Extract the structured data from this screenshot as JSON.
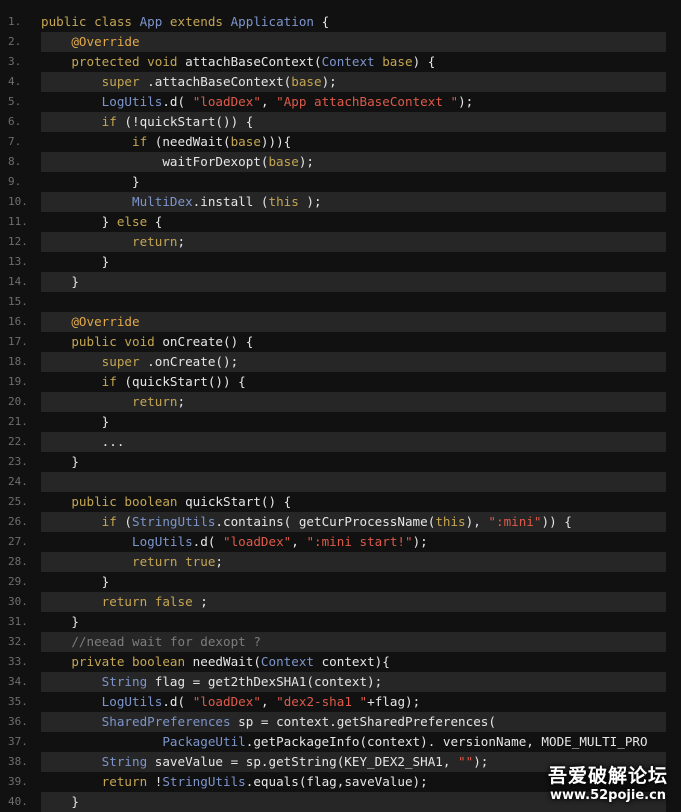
{
  "lines": [
    [
      [
        "kw",
        "public class "
      ],
      [
        "cls",
        "App"
      ],
      [
        "kw",
        " extends "
      ],
      [
        "cls",
        "Application"
      ],
      [
        "txt",
        " {"
      ]
    ],
    [
      [
        "txt",
        "    "
      ],
      [
        "ann",
        "@Override"
      ]
    ],
    [
      [
        "txt",
        "    "
      ],
      [
        "kw",
        "protected void "
      ],
      [
        "txt",
        "attachBaseContext("
      ],
      [
        "cls",
        "Context"
      ],
      [
        "kw",
        " base"
      ],
      [
        "txt",
        ") {"
      ]
    ],
    [
      [
        "txt",
        "        "
      ],
      [
        "kw",
        "super"
      ],
      [
        "txt",
        " .attachBaseContext("
      ],
      [
        "kw",
        "base"
      ],
      [
        "txt",
        ");"
      ]
    ],
    [
      [
        "txt",
        "        "
      ],
      [
        "cls",
        "LogUtils"
      ],
      [
        "txt",
        ".d( "
      ],
      [
        "str",
        "\"loadDex\""
      ],
      [
        "txt",
        ", "
      ],
      [
        "str",
        "\"App attachBaseContext \""
      ],
      [
        "txt",
        ");"
      ]
    ],
    [
      [
        "txt",
        "        "
      ],
      [
        "kw",
        "if"
      ],
      [
        "txt",
        " (!quickStart()) {"
      ]
    ],
    [
      [
        "txt",
        "            "
      ],
      [
        "kw",
        "if"
      ],
      [
        "txt",
        " (needWait("
      ],
      [
        "kw",
        "base"
      ],
      [
        "txt",
        "))){"
      ]
    ],
    [
      [
        "txt",
        "                waitForDexopt("
      ],
      [
        "kw",
        "base"
      ],
      [
        "txt",
        ");"
      ]
    ],
    [
      [
        "txt",
        "            }"
      ]
    ],
    [
      [
        "txt",
        "            "
      ],
      [
        "cls",
        "MultiDex"
      ],
      [
        "txt",
        ".install ("
      ],
      [
        "kw",
        "this"
      ],
      [
        "txt",
        " );"
      ]
    ],
    [
      [
        "txt",
        "        } "
      ],
      [
        "kw",
        "else"
      ],
      [
        "txt",
        " {"
      ]
    ],
    [
      [
        "txt",
        "            "
      ],
      [
        "kw",
        "return"
      ],
      [
        "txt",
        ";"
      ]
    ],
    [
      [
        "txt",
        "        }"
      ]
    ],
    [
      [
        "txt",
        "    }"
      ]
    ],
    [],
    [
      [
        "txt",
        "    "
      ],
      [
        "ann",
        "@Override"
      ]
    ],
    [
      [
        "txt",
        "    "
      ],
      [
        "kw",
        "public void "
      ],
      [
        "txt",
        "onCreate() {"
      ]
    ],
    [
      [
        "txt",
        "        "
      ],
      [
        "kw",
        "super"
      ],
      [
        "txt",
        " .onCreate();"
      ]
    ],
    [
      [
        "txt",
        "        "
      ],
      [
        "kw",
        "if"
      ],
      [
        "txt",
        " (quickStart()) {"
      ]
    ],
    [
      [
        "txt",
        "            "
      ],
      [
        "kw",
        "return"
      ],
      [
        "txt",
        ";"
      ]
    ],
    [
      [
        "txt",
        "        }"
      ]
    ],
    [
      [
        "txt",
        "        ..."
      ]
    ],
    [
      [
        "txt",
        "    }"
      ]
    ],
    [],
    [
      [
        "txt",
        "    "
      ],
      [
        "kw",
        "public boolean "
      ],
      [
        "txt",
        "quickStart() {"
      ]
    ],
    [
      [
        "txt",
        "        "
      ],
      [
        "kw",
        "if"
      ],
      [
        "txt",
        " ("
      ],
      [
        "cls",
        "StringUtils"
      ],
      [
        "txt",
        ".contains( getCurProcessName("
      ],
      [
        "kw",
        "this"
      ],
      [
        "txt",
        "), "
      ],
      [
        "str",
        "\":mini\""
      ],
      [
        "txt",
        ")) {"
      ]
    ],
    [
      [
        "txt",
        "            "
      ],
      [
        "cls",
        "LogUtils"
      ],
      [
        "txt",
        ".d( "
      ],
      [
        "str",
        "\"loadDex\""
      ],
      [
        "txt",
        ", "
      ],
      [
        "str",
        "\":mini start!\""
      ],
      [
        "txt",
        ");"
      ]
    ],
    [
      [
        "txt",
        "            "
      ],
      [
        "kw",
        "return true"
      ],
      [
        "txt",
        ";"
      ]
    ],
    [
      [
        "txt",
        "        }"
      ]
    ],
    [
      [
        "txt",
        "        "
      ],
      [
        "kw",
        "return false"
      ],
      [
        "txt",
        " ;"
      ]
    ],
    [
      [
        "txt",
        "    }"
      ]
    ],
    [
      [
        "txt",
        "    "
      ],
      [
        "cmt",
        "//neead wait for dexopt ?"
      ]
    ],
    [
      [
        "txt",
        "    "
      ],
      [
        "kw",
        "private boolean "
      ],
      [
        "txt",
        "needWait("
      ],
      [
        "cls",
        "Context"
      ],
      [
        "txt",
        " context){"
      ]
    ],
    [
      [
        "txt",
        "        "
      ],
      [
        "cls",
        "String"
      ],
      [
        "txt",
        " flag = get2thDexSHA1(context);"
      ]
    ],
    [
      [
        "txt",
        "        "
      ],
      [
        "cls",
        "LogUtils"
      ],
      [
        "txt",
        ".d( "
      ],
      [
        "str",
        "\"loadDex\""
      ],
      [
        "txt",
        ", "
      ],
      [
        "str",
        "\"dex2-sha1 \""
      ],
      [
        "txt",
        "+flag);"
      ]
    ],
    [
      [
        "txt",
        "        "
      ],
      [
        "cls",
        "SharedPreferences"
      ],
      [
        "txt",
        " sp = context.getSharedPreferences("
      ]
    ],
    [
      [
        "txt",
        "                "
      ],
      [
        "cls",
        "PackageUtil"
      ],
      [
        "txt",
        ".getPackageInfo(context). versionName, MODE_MULTI_PRO"
      ]
    ],
    [
      [
        "txt",
        "        "
      ],
      [
        "cls",
        "String"
      ],
      [
        "txt",
        " saveValue = sp.getString(KEY_DEX2_SHA1, "
      ],
      [
        "str",
        "\"\""
      ],
      [
        "txt",
        ");"
      ]
    ],
    [
      [
        "txt",
        "        "
      ],
      [
        "kw",
        "return"
      ],
      [
        "txt",
        " !"
      ],
      [
        "cls",
        "StringUtils"
      ],
      [
        "txt",
        ".equals(flag,saveValue);"
      ]
    ],
    [
      [
        "txt",
        "    }"
      ]
    ]
  ],
  "watermark": {
    "title": "吾爱破解论坛",
    "url": "www.52pojie.cn"
  }
}
